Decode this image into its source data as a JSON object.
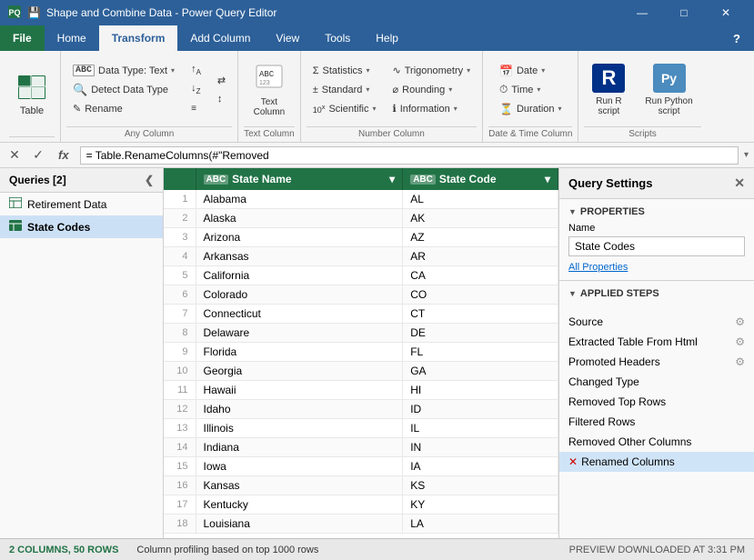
{
  "titleBar": {
    "title": "Shape and Combine Data - Power Query Editor",
    "saveIcon": "💾",
    "undoIcon": "↩",
    "redoIcon": "↪"
  },
  "ribbon": {
    "tabs": [
      {
        "id": "file",
        "label": "File",
        "class": "file"
      },
      {
        "id": "home",
        "label": "Home",
        "class": ""
      },
      {
        "id": "transform",
        "label": "Transform",
        "class": "active"
      },
      {
        "id": "addColumn",
        "label": "Add Column",
        "class": ""
      },
      {
        "id": "view",
        "label": "View",
        "class": ""
      },
      {
        "id": "tools",
        "label": "Tools",
        "class": ""
      },
      {
        "id": "help",
        "label": "Help",
        "class": ""
      }
    ],
    "groups": {
      "anyColumn": {
        "label": "Any Column",
        "dataType": "Data Type: Text",
        "detectDataType": "Detect Data Type",
        "rename": "Rename"
      },
      "textColumn": {
        "label": "Text Column",
        "buttonLabel": "Text\nColumn"
      },
      "numberColumn": {
        "label": "Number Column",
        "statistics": "Statistics",
        "standard": "Standard",
        "scientific": "Scientific",
        "trigonometry": "Trigonometry",
        "rounding": "Rounding",
        "information": "Information"
      },
      "dateTimeColumn": {
        "label": "Date & Time Column",
        "date": "Date",
        "time": "Time",
        "duration": "Duration"
      },
      "scripts": {
        "label": "Scripts",
        "runR": "Run R\nscript",
        "runPython": "Run Python\nscript"
      }
    }
  },
  "formulaBar": {
    "expression": "= Table.RenameColumns(#\"Removed"
  },
  "sidebar": {
    "header": "Queries [2]",
    "items": [
      {
        "id": "retirement",
        "label": "Retirement Data",
        "icon": "table"
      },
      {
        "id": "stateCodes",
        "label": "State Codes",
        "icon": "table",
        "active": true
      }
    ]
  },
  "dataGrid": {
    "columns": [
      {
        "id": "rowNum",
        "label": "#",
        "type": ""
      },
      {
        "id": "stateName",
        "label": "State Name",
        "type": "ABC"
      },
      {
        "id": "stateCode",
        "label": "State Code",
        "type": "ABC"
      }
    ],
    "rows": [
      {
        "num": 1,
        "stateName": "Alabama",
        "stateCode": "AL"
      },
      {
        "num": 2,
        "stateName": "Alaska",
        "stateCode": "AK"
      },
      {
        "num": 3,
        "stateName": "Arizona",
        "stateCode": "AZ"
      },
      {
        "num": 4,
        "stateName": "Arkansas",
        "stateCode": "AR"
      },
      {
        "num": 5,
        "stateName": "California",
        "stateCode": "CA"
      },
      {
        "num": 6,
        "stateName": "Colorado",
        "stateCode": "CO"
      },
      {
        "num": 7,
        "stateName": "Connecticut",
        "stateCode": "CT"
      },
      {
        "num": 8,
        "stateName": "Delaware",
        "stateCode": "DE"
      },
      {
        "num": 9,
        "stateName": "Florida",
        "stateCode": "FL"
      },
      {
        "num": 10,
        "stateName": "Georgia",
        "stateCode": "GA"
      },
      {
        "num": 11,
        "stateName": "Hawaii",
        "stateCode": "HI"
      },
      {
        "num": 12,
        "stateName": "Idaho",
        "stateCode": "ID"
      },
      {
        "num": 13,
        "stateName": "Illinois",
        "stateCode": "IL"
      },
      {
        "num": 14,
        "stateName": "Indiana",
        "stateCode": "IN"
      },
      {
        "num": 15,
        "stateName": "Iowa",
        "stateCode": "IA"
      },
      {
        "num": 16,
        "stateName": "Kansas",
        "stateCode": "KS"
      },
      {
        "num": 17,
        "stateName": "Kentucky",
        "stateCode": "KY"
      },
      {
        "num": 18,
        "stateName": "Louisiana",
        "stateCode": "LA"
      }
    ]
  },
  "querySettings": {
    "title": "Query Settings",
    "propertiesLabel": "PROPERTIES",
    "nameLabel": "Name",
    "nameValue": "State Codes",
    "allPropertiesLink": "All Properties",
    "appliedStepsLabel": "APPLIED STEPS",
    "steps": [
      {
        "id": "source",
        "label": "Source",
        "hasGear": true
      },
      {
        "id": "extractedTable",
        "label": "Extracted Table From Html",
        "hasGear": true
      },
      {
        "id": "promotedHeaders",
        "label": "Promoted Headers",
        "hasGear": true
      },
      {
        "id": "changedType",
        "label": "Changed Type",
        "hasGear": false
      },
      {
        "id": "removedTopRows",
        "label": "Removed Top Rows",
        "hasGear": false
      },
      {
        "id": "filteredRows",
        "label": "Filtered Rows",
        "hasGear": false
      },
      {
        "id": "removedOtherColumns",
        "label": "Removed Other Columns",
        "hasGear": false
      },
      {
        "id": "renamedColumns",
        "label": "Renamed Columns",
        "active": true,
        "hasError": true,
        "hasGear": false
      }
    ]
  },
  "statusBar": {
    "columns": "2 COLUMNS, 50 ROWS",
    "profiling": "Column profiling based on top 1000 rows",
    "preview": "PREVIEW DOWNLOADED AT 3:31 PM"
  }
}
